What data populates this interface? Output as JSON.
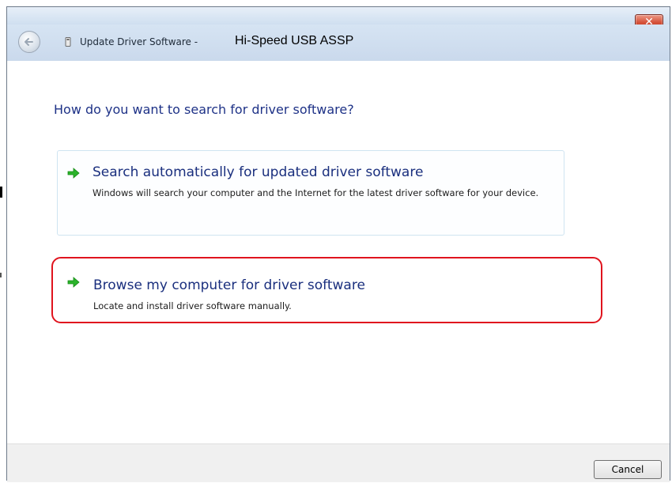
{
  "window": {
    "close_label": "✕",
    "title_prefix": "Update Driver Software -",
    "device_name": "Hi-Speed USB ASSP"
  },
  "main": {
    "question": "How do you want to search for driver software?",
    "options": [
      {
        "icon": "green-arrow-icon",
        "title": "Search automatically for updated driver software",
        "description": "Windows will search your computer and the Internet for the latest driver software for your device."
      },
      {
        "icon": "green-arrow-icon",
        "title": "Browse my computer for driver software",
        "description": "Locate and install driver software manually.",
        "highlight_color": "#e0141e"
      }
    ]
  },
  "footer": {
    "cancel_label": "Cancel"
  },
  "colors": {
    "accent_text": "#1e3287",
    "arrow": "#2bb32b",
    "highlight": "#e0141e"
  }
}
